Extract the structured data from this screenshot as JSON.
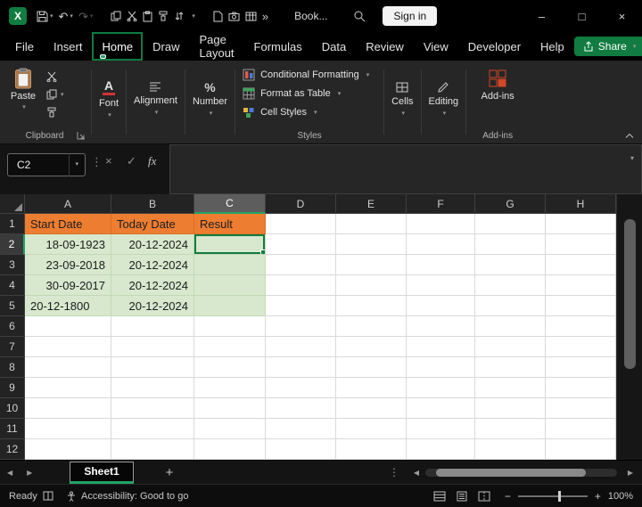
{
  "icons": {
    "logo_letter": "X",
    "undo": "↶",
    "redo": "↷",
    "chevron_down": "▾",
    "more_chevrons": "»",
    "minimize": "–",
    "maximize": "□",
    "close": "×",
    "dots_vertical": "⋮",
    "cancel": "×",
    "check": "✓",
    "fx": "fx",
    "nav_left": "◀",
    "nav_right": "▶",
    "plus": "+",
    "font_letter": "A",
    "percent": "%",
    "minus": "−"
  },
  "titlebar": {
    "title": "Book...",
    "signin_label": "Sign in"
  },
  "tabs": {
    "items": [
      "File",
      "Insert",
      "Home",
      "Draw",
      "Page Layout",
      "Formulas",
      "Data",
      "Review",
      "View",
      "Developer",
      "Help"
    ],
    "share_label": "Share"
  },
  "ribbon": {
    "paste_label": "Paste",
    "font_label": "Font",
    "alignment_label": "Alignment",
    "number_label": "Number",
    "conditional_formatting_label": "Conditional Formatting",
    "format_as_table_label": "Format as Table",
    "cell_styles_label": "Cell Styles",
    "cells_label": "Cells",
    "editing_label": "Editing",
    "addins_label": "Add-ins",
    "group_clipboard": "Clipboard",
    "group_styles": "Styles",
    "group_addins": "Add-ins"
  },
  "formula_bar": {
    "name_box_value": "C2",
    "formula_value": ""
  },
  "grid": {
    "column_headers": [
      "A",
      "B",
      "C",
      "D",
      "E",
      "F",
      "G",
      "H"
    ],
    "row_headers": [
      "1",
      "2",
      "3",
      "4",
      "5",
      "6",
      "7",
      "8",
      "9",
      "10",
      "11",
      "12"
    ],
    "header_cells": [
      "Start Date",
      "Today Date",
      "Result"
    ],
    "rows": [
      [
        "18-09-1923",
        "20-12-2024",
        ""
      ],
      [
        "23-09-2018",
        "20-12-2024",
        ""
      ],
      [
        "30-09-2017",
        "20-12-2024",
        ""
      ],
      [
        "20-12-1800",
        "20-12-2024",
        ""
      ]
    ],
    "selected_cell": "C2",
    "colors": {
      "header_fill": "#ED7D31",
      "data_fill": "#D7E8CE",
      "accent_green": "#21A366"
    }
  },
  "sheet_bar": {
    "sheet_name": "Sheet1"
  },
  "status_bar": {
    "ready_label": "Ready",
    "accessibility_label": "Accessibility: Good to go",
    "zoom_label": "100%"
  }
}
